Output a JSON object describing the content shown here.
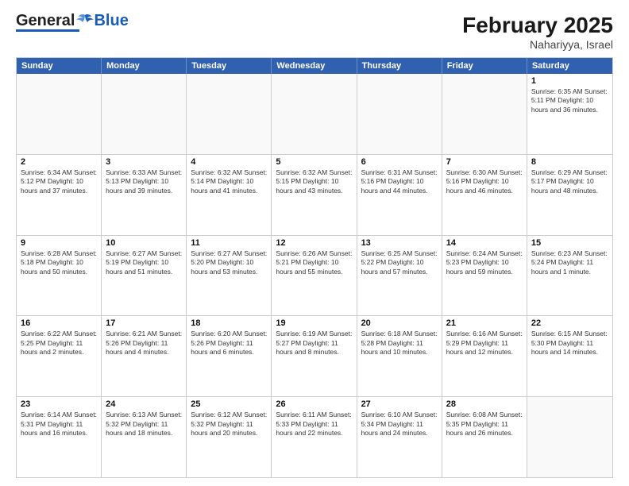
{
  "header": {
    "logo_general": "General",
    "logo_blue": "Blue",
    "month_title": "February 2025",
    "subtitle": "Nahariyya, Israel"
  },
  "calendar": {
    "days_of_week": [
      "Sunday",
      "Monday",
      "Tuesday",
      "Wednesday",
      "Thursday",
      "Friday",
      "Saturday"
    ],
    "rows": [
      [
        {
          "day": "",
          "empty": true
        },
        {
          "day": "",
          "empty": true
        },
        {
          "day": "",
          "empty": true
        },
        {
          "day": "",
          "empty": true
        },
        {
          "day": "",
          "empty": true
        },
        {
          "day": "",
          "empty": true
        },
        {
          "day": "1",
          "text": "Sunrise: 6:35 AM\nSunset: 5:11 PM\nDaylight: 10 hours\nand 36 minutes."
        }
      ],
      [
        {
          "day": "2",
          "text": "Sunrise: 6:34 AM\nSunset: 5:12 PM\nDaylight: 10 hours\nand 37 minutes."
        },
        {
          "day": "3",
          "text": "Sunrise: 6:33 AM\nSunset: 5:13 PM\nDaylight: 10 hours\nand 39 minutes."
        },
        {
          "day": "4",
          "text": "Sunrise: 6:32 AM\nSunset: 5:14 PM\nDaylight: 10 hours\nand 41 minutes."
        },
        {
          "day": "5",
          "text": "Sunrise: 6:32 AM\nSunset: 5:15 PM\nDaylight: 10 hours\nand 43 minutes."
        },
        {
          "day": "6",
          "text": "Sunrise: 6:31 AM\nSunset: 5:16 PM\nDaylight: 10 hours\nand 44 minutes."
        },
        {
          "day": "7",
          "text": "Sunrise: 6:30 AM\nSunset: 5:16 PM\nDaylight: 10 hours\nand 46 minutes."
        },
        {
          "day": "8",
          "text": "Sunrise: 6:29 AM\nSunset: 5:17 PM\nDaylight: 10 hours\nand 48 minutes."
        }
      ],
      [
        {
          "day": "9",
          "text": "Sunrise: 6:28 AM\nSunset: 5:18 PM\nDaylight: 10 hours\nand 50 minutes."
        },
        {
          "day": "10",
          "text": "Sunrise: 6:27 AM\nSunset: 5:19 PM\nDaylight: 10 hours\nand 51 minutes."
        },
        {
          "day": "11",
          "text": "Sunrise: 6:27 AM\nSunset: 5:20 PM\nDaylight: 10 hours\nand 53 minutes."
        },
        {
          "day": "12",
          "text": "Sunrise: 6:26 AM\nSunset: 5:21 PM\nDaylight: 10 hours\nand 55 minutes."
        },
        {
          "day": "13",
          "text": "Sunrise: 6:25 AM\nSunset: 5:22 PM\nDaylight: 10 hours\nand 57 minutes."
        },
        {
          "day": "14",
          "text": "Sunrise: 6:24 AM\nSunset: 5:23 PM\nDaylight: 10 hours\nand 59 minutes."
        },
        {
          "day": "15",
          "text": "Sunrise: 6:23 AM\nSunset: 5:24 PM\nDaylight: 11 hours\nand 1 minute."
        }
      ],
      [
        {
          "day": "16",
          "text": "Sunrise: 6:22 AM\nSunset: 5:25 PM\nDaylight: 11 hours\nand 2 minutes."
        },
        {
          "day": "17",
          "text": "Sunrise: 6:21 AM\nSunset: 5:26 PM\nDaylight: 11 hours\nand 4 minutes."
        },
        {
          "day": "18",
          "text": "Sunrise: 6:20 AM\nSunset: 5:26 PM\nDaylight: 11 hours\nand 6 minutes."
        },
        {
          "day": "19",
          "text": "Sunrise: 6:19 AM\nSunset: 5:27 PM\nDaylight: 11 hours\nand 8 minutes."
        },
        {
          "day": "20",
          "text": "Sunrise: 6:18 AM\nSunset: 5:28 PM\nDaylight: 11 hours\nand 10 minutes."
        },
        {
          "day": "21",
          "text": "Sunrise: 6:16 AM\nSunset: 5:29 PM\nDaylight: 11 hours\nand 12 minutes."
        },
        {
          "day": "22",
          "text": "Sunrise: 6:15 AM\nSunset: 5:30 PM\nDaylight: 11 hours\nand 14 minutes."
        }
      ],
      [
        {
          "day": "23",
          "text": "Sunrise: 6:14 AM\nSunset: 5:31 PM\nDaylight: 11 hours\nand 16 minutes."
        },
        {
          "day": "24",
          "text": "Sunrise: 6:13 AM\nSunset: 5:32 PM\nDaylight: 11 hours\nand 18 minutes."
        },
        {
          "day": "25",
          "text": "Sunrise: 6:12 AM\nSunset: 5:32 PM\nDaylight: 11 hours\nand 20 minutes."
        },
        {
          "day": "26",
          "text": "Sunrise: 6:11 AM\nSunset: 5:33 PM\nDaylight: 11 hours\nand 22 minutes."
        },
        {
          "day": "27",
          "text": "Sunrise: 6:10 AM\nSunset: 5:34 PM\nDaylight: 11 hours\nand 24 minutes."
        },
        {
          "day": "28",
          "text": "Sunrise: 6:08 AM\nSunset: 5:35 PM\nDaylight: 11 hours\nand 26 minutes."
        },
        {
          "day": "",
          "empty": true
        }
      ]
    ]
  }
}
